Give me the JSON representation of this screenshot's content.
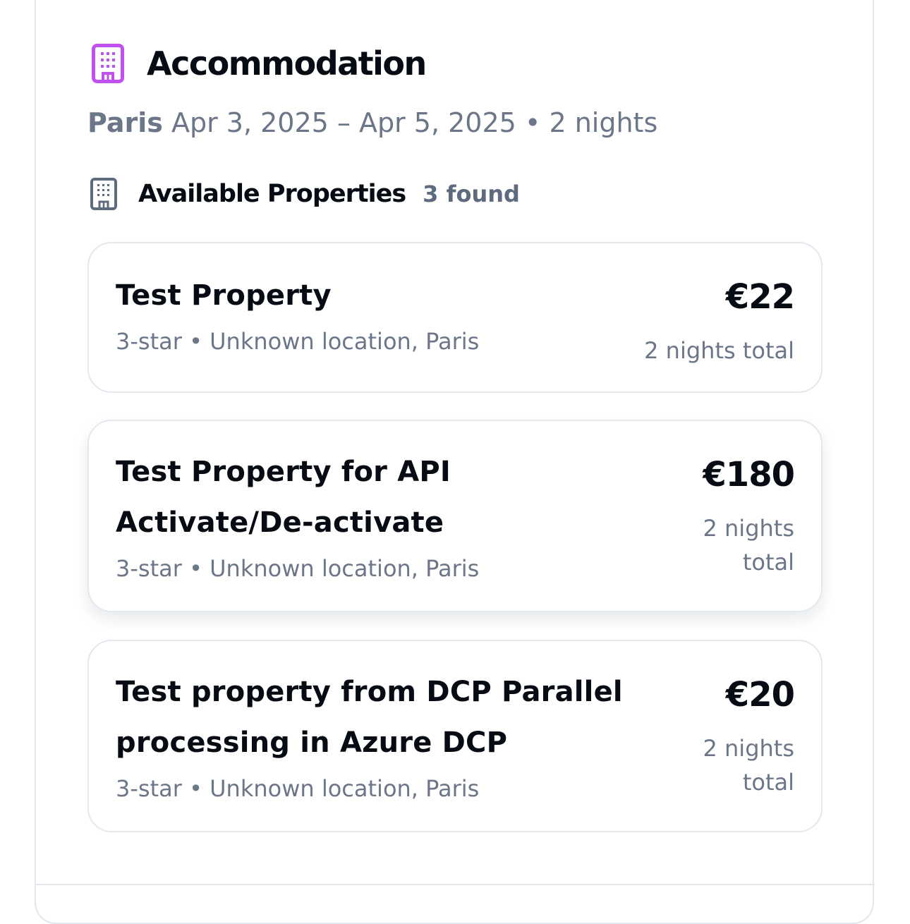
{
  "section": {
    "title": "Accommodation",
    "city": "Paris",
    "dates": "Apr 3, 2025 – Apr 5, 2025",
    "separator": "•",
    "nights": "2 nights"
  },
  "properties_header": {
    "title": "Available Properties",
    "count": "3 found"
  },
  "properties": [
    {
      "name": "Test Property",
      "meta": "3-star • Unknown location, Paris",
      "price": "€22",
      "total": "2 nights total"
    },
    {
      "name": "Test Property for API Activate/De-activate",
      "meta": "3-star • Unknown location, Paris",
      "price": "€180",
      "total": "2 nights total"
    },
    {
      "name": "Test property from DCP Parallel processing in Azure DCP",
      "meta": "3-star • Unknown location, Paris",
      "price": "€20",
      "total": "2 nights total"
    }
  ],
  "colors": {
    "accent_icon": "#c24ff0",
    "muted_text": "#6b7689",
    "heading_text": "#070b14",
    "border": "#e3e8ef"
  },
  "icons": {
    "section_icon": "building-icon",
    "properties_icon": "building-icon"
  }
}
